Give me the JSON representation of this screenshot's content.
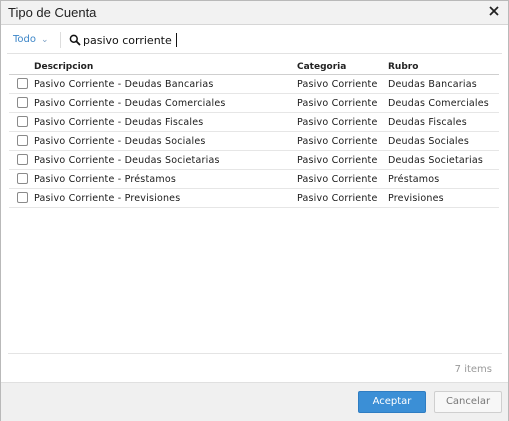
{
  "dialog": {
    "title": "Tipo de Cuenta"
  },
  "search": {
    "scope_label": "Todo",
    "query": "pasivo corriente"
  },
  "table": {
    "headers": {
      "description": "Descripcion",
      "category": "Categoria",
      "rubro": "Rubro"
    },
    "rows": [
      {
        "description": "Pasivo Corriente - Deudas Bancarias",
        "category": "Pasivo Corriente",
        "rubro": "Deudas Bancarias",
        "checked": false
      },
      {
        "description": "Pasivo Corriente - Deudas Comerciales",
        "category": "Pasivo Corriente",
        "rubro": "Deudas Comerciales",
        "checked": false
      },
      {
        "description": "Pasivo Corriente - Deudas Fiscales",
        "category": "Pasivo Corriente",
        "rubro": "Deudas Fiscales",
        "checked": false
      },
      {
        "description": "Pasivo Corriente - Deudas Sociales",
        "category": "Pasivo Corriente",
        "rubro": "Deudas Sociales",
        "checked": false
      },
      {
        "description": "Pasivo Corriente - Deudas Societarias",
        "category": "Pasivo Corriente",
        "rubro": "Deudas Societarias",
        "checked": false
      },
      {
        "description": "Pasivo Corriente - Préstamos",
        "category": "Pasivo Corriente",
        "rubro": "Préstamos",
        "checked": false
      },
      {
        "description": "Pasivo Corriente - Previsiones",
        "category": "Pasivo Corriente",
        "rubro": "Previsiones",
        "checked": false
      }
    ]
  },
  "footer": {
    "item_count": "7 items"
  },
  "actions": {
    "accept_label": "Aceptar",
    "cancel_label": "Cancelar"
  },
  "colors": {
    "accent": "#3b8fd6",
    "link": "#3d86c8"
  }
}
